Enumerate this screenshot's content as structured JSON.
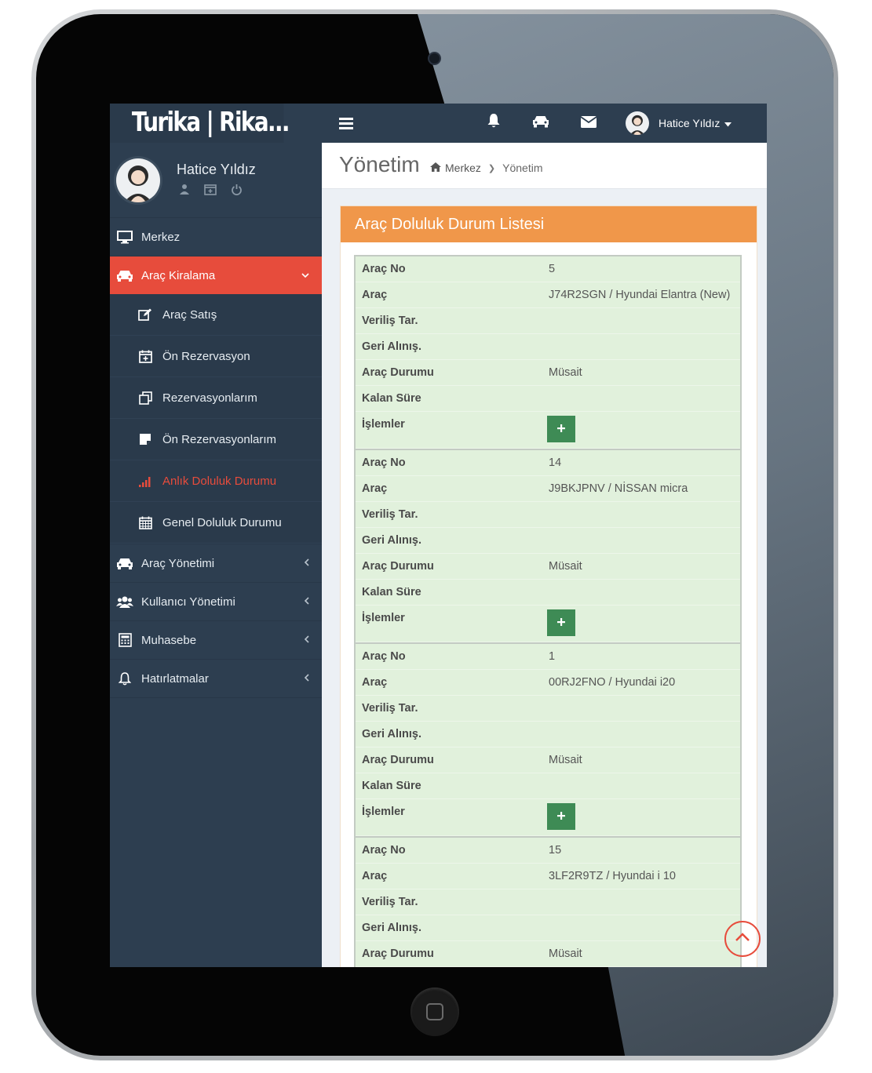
{
  "brand": "Turika | Rika...",
  "user": {
    "name": "Hatice Yıldız",
    "topbar_name": "Hatice Yıldız"
  },
  "sidebar": {
    "items": [
      {
        "label": "Merkez",
        "icon": "monitor-icon"
      },
      {
        "label": "Araç Kiralama",
        "icon": "car-icon",
        "active": true,
        "children": [
          {
            "label": "Araç Satış",
            "icon": "edit-icon"
          },
          {
            "label": "Ön Rezervasyon",
            "icon": "calendar-plus-icon"
          },
          {
            "label": "Rezervasyonlarım",
            "icon": "copy-icon"
          },
          {
            "label": "Ön Rezervasyonlarım",
            "icon": "sticky-note-icon"
          },
          {
            "label": "Anlık Doluluk Durumu",
            "icon": "signal-icon",
            "current": true
          },
          {
            "label": "Genel Doluluk Durumu",
            "icon": "calendar-icon"
          }
        ]
      },
      {
        "label": "Araç Yönetimi",
        "icon": "car-icon"
      },
      {
        "label": "Kullanıcı Yönetimi",
        "icon": "users-icon"
      },
      {
        "label": "Muhasebe",
        "icon": "calculator-icon"
      },
      {
        "label": "Hatırlatmalar",
        "icon": "bell-icon"
      }
    ]
  },
  "header": {
    "title": "Yönetim",
    "breadcrumb": [
      "Merkez",
      "Yönetim"
    ]
  },
  "panel": {
    "title": "Araç Doluluk Durum Listesi"
  },
  "labels": {
    "arac_no": "Araç No",
    "arac": "Araç",
    "verilis": "Veriliş Tar.",
    "geri": "Geri Alınış.",
    "durum": "Araç Durumu",
    "kalan": "Kalan Süre",
    "islemler": "İşlemler"
  },
  "cars": [
    {
      "no": "5",
      "arac": "J74R2SGN / Hyundai Elantra (New)",
      "verilis": "",
      "geri": "",
      "durum": "Müsait",
      "kalan": ""
    },
    {
      "no": "14",
      "arac": "J9BKJPNV / NİSSAN micra",
      "verilis": "",
      "geri": "",
      "durum": "Müsait",
      "kalan": ""
    },
    {
      "no": "1",
      "arac": "00RJ2FNO / Hyundai i20",
      "verilis": "",
      "geri": "",
      "durum": "Müsait",
      "kalan": ""
    },
    {
      "no": "15",
      "arac": "3LF2R9TZ / Hyundai i 10",
      "verilis": "",
      "geri": "",
      "durum": "Müsait",
      "kalan": ""
    }
  ],
  "colors": {
    "sidebar_bg": "#2d3e50",
    "active_red": "#e74c3c",
    "panel_orange": "#f0974a",
    "row_green": "#e1f1dc",
    "button_green": "#3e8b55"
  }
}
